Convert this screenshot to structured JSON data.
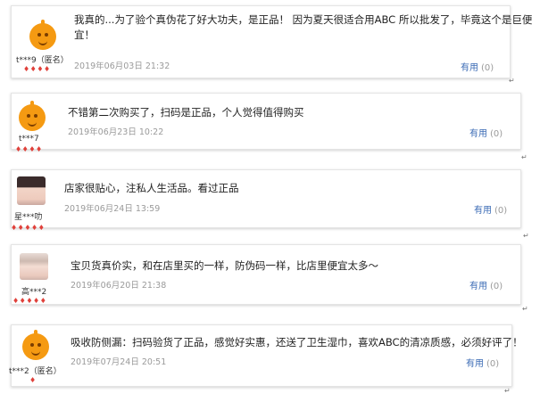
{
  "reviews": [
    {
      "user": "t***9（匿名）",
      "hearts": "♦♦♦♦",
      "text_lines": [
        "我真的...为了验个真伪花了好大功夫，是正品！ 因为夏天很适合用ABC 所以批发了，毕竟这个是巨便",
        "宜！"
      ],
      "date": "2019年06月03日 21:32",
      "useful_label": "有用",
      "useful_count": "(0)",
      "avatar": "orange-mascot-avatar"
    },
    {
      "user": "t***7",
      "hearts": "♦♦♦♦",
      "text_lines": [
        "不错第二次购买了，扫码是正品，个人觉得值得购买"
      ],
      "date": "2019年06月23日 10:22",
      "useful_label": "有用",
      "useful_count": "(0)",
      "avatar": "orange-mascot-avatar"
    },
    {
      "user": "星***叻",
      "hearts": "♦♦♦♦♦",
      "text_lines": [
        "店家很贴心，注私人生活品。看过正品"
      ],
      "date": "2019年06月24日 13:59",
      "useful_label": "有用",
      "useful_count": "(0)",
      "avatar": "user-photo-avatar"
    },
    {
      "user": "高***2",
      "hearts": "♦♦♦♦♦",
      "text_lines": [
        "宝贝货真价实，和在店里买的一样，防伪码一样，比店里便宜太多～"
      ],
      "date": "2019年06月20日 21:38",
      "useful_label": "有用",
      "useful_count": "(0)",
      "avatar": "user-photo-avatar"
    },
    {
      "user": "t***2（匿名）",
      "hearts": "♦",
      "text_lines": [
        "吸收防侧漏：扫码验货了正品，感觉好实惠，还送了卫生湿巾，喜欢ABC的清凉质感，必须好评了！"
      ],
      "date": "2019年07月24日 20:51",
      "useful_label": "有用",
      "useful_count": "(0)",
      "avatar": "orange-mascot-avatar"
    }
  ],
  "paragraph_mark": "↵"
}
